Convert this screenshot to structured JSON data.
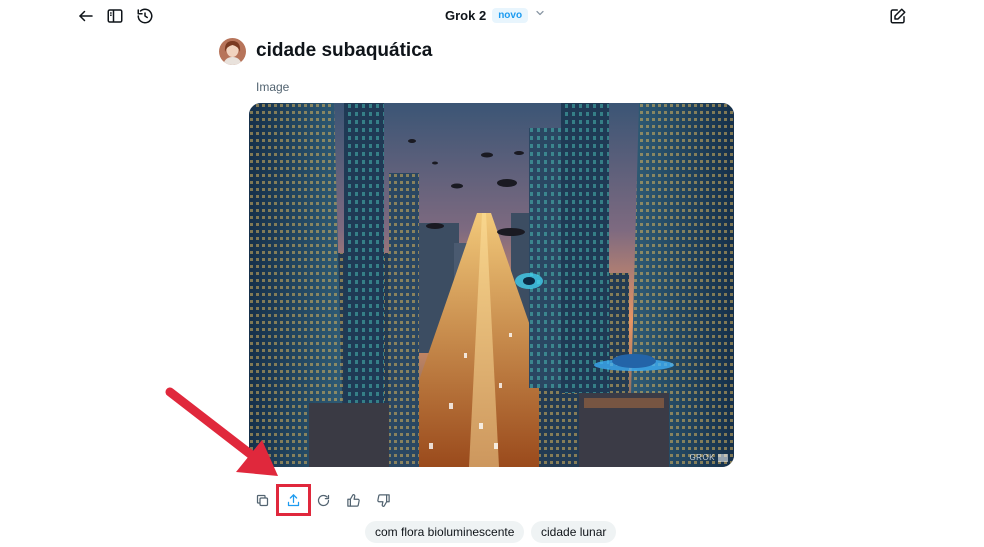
{
  "header": {
    "model_name": "Grok 2",
    "model_badge": "novo"
  },
  "icons": {
    "back": "arrow-left-icon",
    "sidebar": "sidebar-panel-icon",
    "history": "history-icon",
    "compose": "compose-icon",
    "model_dropdown": "chevron-down-icon"
  },
  "message": {
    "title": "cidade subaquática",
    "label": "Image",
    "watermark": "GROK"
  },
  "actions": [
    {
      "name": "copy",
      "icon": "copy-icon"
    },
    {
      "name": "share",
      "icon": "share-upload-icon",
      "highlighted": true
    },
    {
      "name": "regenerate",
      "icon": "refresh-icon"
    },
    {
      "name": "like",
      "icon": "thumbs-up-icon"
    },
    {
      "name": "dislike",
      "icon": "thumbs-down-icon"
    }
  ],
  "suggestions": [
    "com flora bioluminescente",
    "cidade lunar"
  ],
  "colors": {
    "accent": "#1d9bf0",
    "annotation": "#e0283c",
    "text": "#0f1419",
    "muted": "#536471",
    "chip_bg": "#eff3f4"
  }
}
